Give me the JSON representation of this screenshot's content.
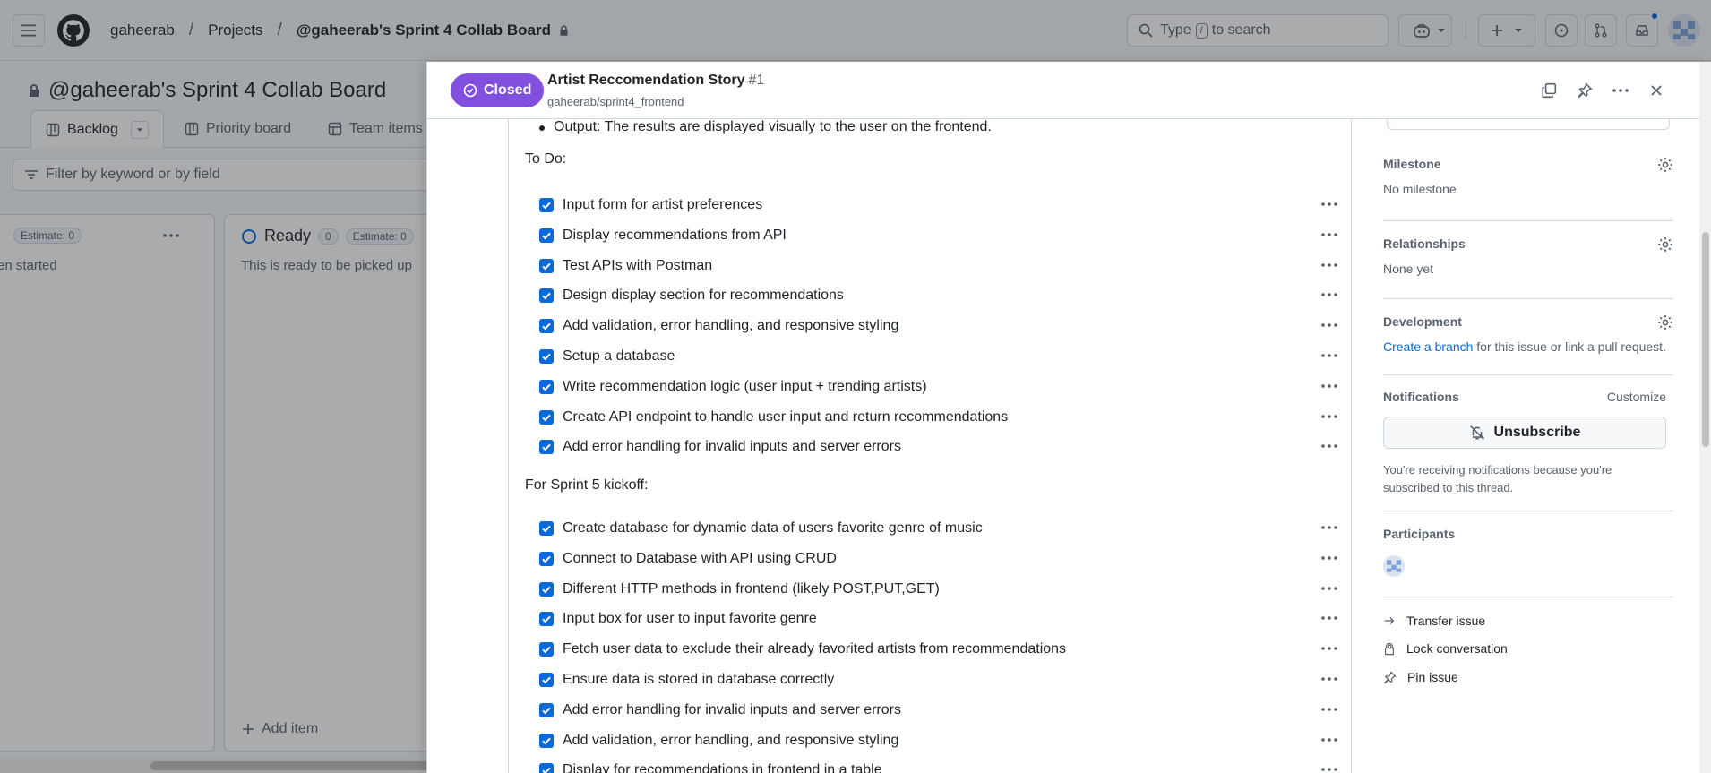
{
  "header": {
    "breadcrumbs": [
      "gaheerab",
      "Projects",
      "@gaheerab's Sprint 4 Collab Board"
    ],
    "search_prefix": "Type",
    "search_key": "/",
    "search_suffix": "to search"
  },
  "board": {
    "title": "@gaheerab's Sprint 4 Collab Board",
    "tabs": [
      "Backlog",
      "Priority board",
      "Team items"
    ],
    "filter_placeholder": "Filter by keyword or by field",
    "columns": [
      {
        "name": "",
        "count": "",
        "estimate": "Estimate: 0",
        "description": "en started"
      },
      {
        "name": "Ready",
        "count": "0",
        "estimate": "Estimate: 0",
        "description": "This is ready to be picked up"
      }
    ],
    "add_item": "Add item"
  },
  "issue": {
    "status": "Closed",
    "title": "Artist Reccomendation Story",
    "number": "#1",
    "repo": "gaheerab/sprint4_frontend",
    "bullet": "Output: The results are displayed visually to the user on the frontend.",
    "todo_heading": "To Do:",
    "todo": [
      "Input form for artist preferences",
      "Display recommendations from API",
      "Test APIs with Postman",
      "Design display section for recommendations",
      "Add validation, error handling, and responsive styling",
      "Setup a database",
      "Write recommendation logic (user input + trending artists)",
      "Create API endpoint to handle user input and return recommendations",
      "Add error handling for invalid inputs and server errors"
    ],
    "kickoff_heading": "For Sprint 5 kickoff:",
    "kickoff": [
      "Create database for dynamic data of users favorite genre of music",
      "Connect to Database with API using CRUD",
      "Different HTTP methods in frontend (likely POST,PUT,GET)",
      "Input box for user to input favorite genre",
      "Fetch user data to exclude their already favorited artists from recommendations",
      "Ensure data is stored in database correctly",
      "Add error handling for invalid inputs and server errors",
      "Add validation, error handling, and responsive styling",
      "Display for recommendations in frontend in a table"
    ]
  },
  "sidebar": {
    "milestone": {
      "label": "Milestone",
      "value": "No milestone"
    },
    "relationships": {
      "label": "Relationships",
      "value": "None yet"
    },
    "development": {
      "label": "Development",
      "link": "Create a branch",
      "rest": "for this issue or link a pull request."
    },
    "notifications": {
      "label": "Notifications",
      "customize": "Customize",
      "button": "Unsubscribe",
      "note": "You're receiving notifications because you're subscribed to this thread."
    },
    "participants": {
      "label": "Participants"
    },
    "actions": [
      "Transfer issue",
      "Lock conversation",
      "Pin issue"
    ]
  },
  "colors": {
    "closed": "#8250df",
    "accent": "#0969da"
  }
}
